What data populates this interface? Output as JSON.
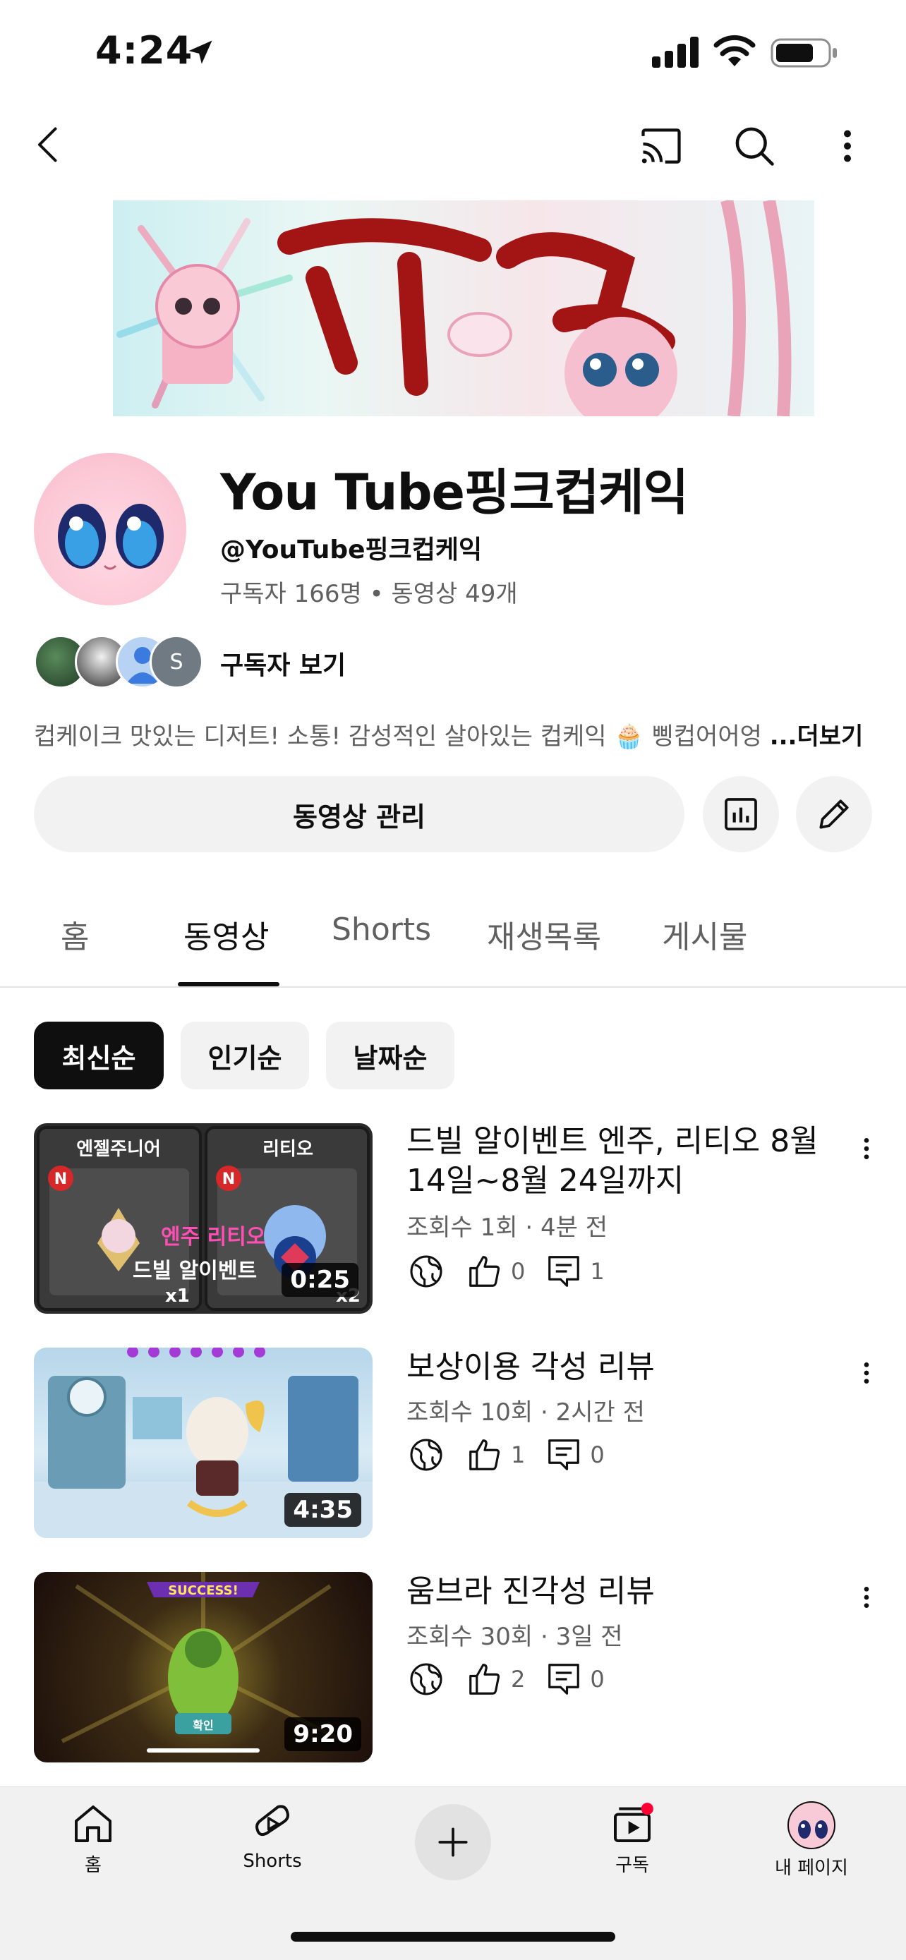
{
  "status_bar": {
    "time": "4:24"
  },
  "channel": {
    "title": "You Tube핑크컵케익",
    "handle": "@YouTube핑크컵케익",
    "stats": "구독자 166명 • 동영상 49개",
    "subscribers_link": "구독자 보기",
    "sub_avatar_letter": "S",
    "description": "컵케이크 맛있는 디저트! 소통! 감성적인 살아있는 컵케익 🧁 삥컵어어엉",
    "more_label": "...더보기",
    "manage_button": "동영상 관리"
  },
  "tabs": [
    {
      "label": "홈"
    },
    {
      "label": "동영상"
    },
    {
      "label": "Shorts"
    },
    {
      "label": "재생목록"
    },
    {
      "label": "게시물"
    }
  ],
  "active_tab": "동영상",
  "filters": [
    {
      "label": "최신순",
      "active": true
    },
    {
      "label": "인기순",
      "active": false
    },
    {
      "label": "날짜순",
      "active": false
    }
  ],
  "videos": [
    {
      "title": "드빌 알이벤트 엔주, 리티오 8월 14일~8월 24일까지",
      "meta": "조회수 1회 · 4분 전",
      "likes": "0",
      "comments": "1",
      "duration": "0:25",
      "thumb_labels": {
        "left": "엔젤주니어",
        "right": "리티오",
        "pink": "엔주 리티오",
        "caption": "드빌 알이벤트",
        "x_left": "x1",
        "x_right": "x2"
      }
    },
    {
      "title": "보상이용 각성 리뷰",
      "meta": "조회수 10회 · 2시간 전",
      "likes": "1",
      "comments": "0",
      "duration": "4:35"
    },
    {
      "title": "움브라 진각성 리뷰",
      "meta": "조회수 30회 · 3일 전",
      "likes": "2",
      "comments": "0",
      "duration": "9:20",
      "thumb_labels": {
        "ribbon": "SUCCESS!",
        "button": "확인"
      }
    }
  ],
  "bottom_nav": [
    {
      "label": "홈",
      "icon": "home-icon"
    },
    {
      "label": "Shorts",
      "icon": "shorts-icon"
    },
    {
      "label": "",
      "icon": "plus-icon"
    },
    {
      "label": "구독",
      "icon": "subscriptions-icon"
    },
    {
      "label": "내 페이지",
      "icon": "avatar"
    }
  ],
  "colors": {
    "text": "#0f0f0f",
    "secondary": "#606060",
    "chip_bg": "#f2f2f2",
    "notification": "#ff0033"
  }
}
